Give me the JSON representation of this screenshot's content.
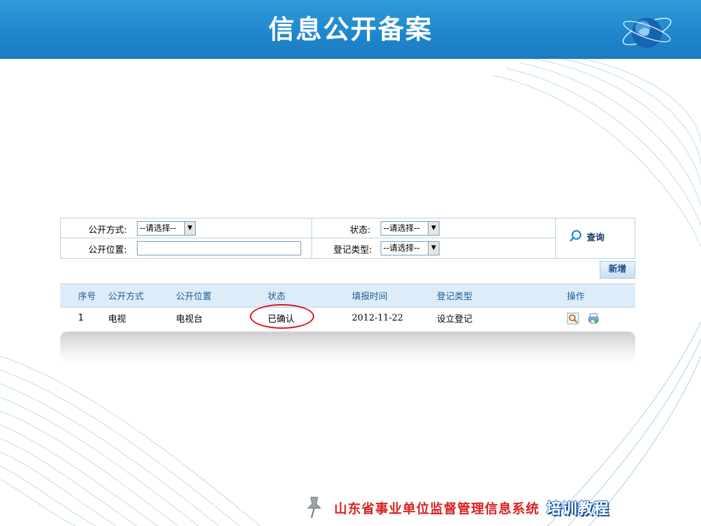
{
  "slide": {
    "title": "信息公开备案",
    "caption": ""
  },
  "filter": {
    "way_label": "公开方式:",
    "way_value": "--请选择--",
    "position_label": "公开位置:",
    "position_value": "",
    "status_label": "状态:",
    "status_value": "--请选择--",
    "regtype_label": "登记类型:",
    "regtype_value": "--请选择--",
    "search_label": "查询"
  },
  "toolbar": {
    "add_label": "新增"
  },
  "table": {
    "headers": [
      "序号",
      "公开方式",
      "公开位置",
      "状态",
      "填报时间",
      "登记类型",
      "操作"
    ],
    "rows": [
      {
        "seq": "1",
        "way": "电视",
        "position": "电视台",
        "status": "已确认",
        "date": "2012-11-22",
        "type": "设立登记"
      }
    ]
  },
  "footer": {
    "main": "山东省事业单位监督管理信息系统",
    "badge": "培训教程"
  },
  "colors": {
    "title_bar": "#1f86cc",
    "highlight_ring": "#d4141a",
    "header_row": "#dcedf9",
    "footer_text": "#d8231f"
  },
  "icons": [
    "globe-icon",
    "search-icon",
    "view-icon",
    "print-icon",
    "pushpin-icon"
  ]
}
